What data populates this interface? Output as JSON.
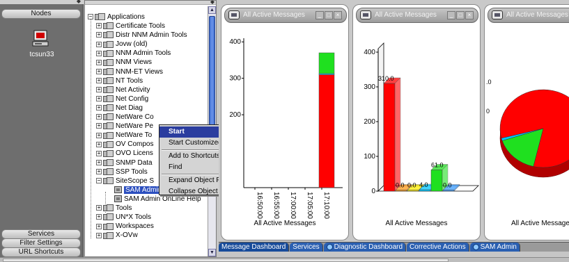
{
  "left_panel": {
    "top_button": "Nodes",
    "host_label": "tcsun33",
    "bottom_buttons": [
      "Services",
      "Filter Settings",
      "URL Shortcuts"
    ]
  },
  "tree": {
    "root": "Applications",
    "items": [
      "Certificate Tools",
      "Distr NNM Admin Tools",
      "Jovw (old)",
      "NNM Admin Tools",
      "NNM Views",
      "NNM-ET Views",
      "NT Tools",
      "Net Activity",
      "Net Config",
      "Net Diag",
      "NetWare Co",
      "NetWare Pe",
      "NetWare To",
      "OV Compos",
      "OVO Licens",
      "SNMP Data",
      "SSP Tools",
      "SiteScope S"
    ],
    "sub_items": [
      "SAM Admin",
      "SAM Admin OnLine Help"
    ],
    "after_items": [
      "Tools",
      "UN*X Tools",
      "Workspaces",
      "X-OVw"
    ]
  },
  "context_menu": {
    "items": [
      "Start",
      "Start Customized...",
      "Add to Shortcuts",
      "Find",
      "Expand Object Pane",
      "Collapse Object Pane"
    ]
  },
  "panes": [
    {
      "title": "All Active Messages",
      "xlabel": "All Active Messages"
    },
    {
      "title": "All Active Messages",
      "xlabel": "All Active Messages"
    },
    {
      "title": "All Active Messages",
      "xlabel": "All Active Messages"
    }
  ],
  "tabs": [
    "Message Dashboard",
    "Services",
    "Diagnostic Dashboard",
    "Corrective Actions",
    "SAM Admin"
  ],
  "colors": {
    "critical": "#ff0000",
    "normal": "#1fe01f",
    "warning": "#00c8ff",
    "selection": "#2b3d9f"
  },
  "chart_data": [
    {
      "type": "bar",
      "title": "All Active Messages",
      "xlabel": "All Active Messages",
      "ylim": [
        0,
        410
      ],
      "yticks": [
        200,
        300,
        400
      ],
      "categories": [
        "16:50:00",
        "16:55:00",
        "17:00:00",
        "17:05:00",
        "17:10:00"
      ],
      "series": [
        {
          "values": [
            0,
            0,
            0,
            0,
            310
          ],
          "color": "#ff0000"
        },
        {
          "values": [
            0,
            0,
            0,
            0,
            3
          ],
          "color": "#00c8ff"
        },
        {
          "values": [
            0,
            0,
            0,
            0,
            57
          ],
          "color": "#1fe01f"
        }
      ]
    },
    {
      "type": "bar",
      "title": "All Active Messages",
      "xlabel": "All Active Messages",
      "ylim": [
        0,
        410
      ],
      "yticks": [
        0,
        100,
        200,
        300,
        400
      ],
      "values": [
        310.0,
        0.0,
        0.0,
        4.0,
        61.0,
        0.0
      ],
      "labels": [
        "310.0",
        "0.0",
        "0.0",
        "4.0",
        "61.0",
        "0.0"
      ],
      "colors": [
        "#ff0000",
        "#ff9a1a",
        "#ffee00",
        "#00c8ff",
        "#1fe01f",
        "#3a9cff"
      ]
    },
    {
      "type": "pie",
      "title": "All Active Messages",
      "xlabel": "All Active Messages",
      "labels": [
        ".0",
        "0"
      ],
      "values": [
        310,
        61,
        4
      ],
      "colors": [
        "#ff0000",
        "#1fe01f",
        "#00c8ff"
      ]
    }
  ]
}
